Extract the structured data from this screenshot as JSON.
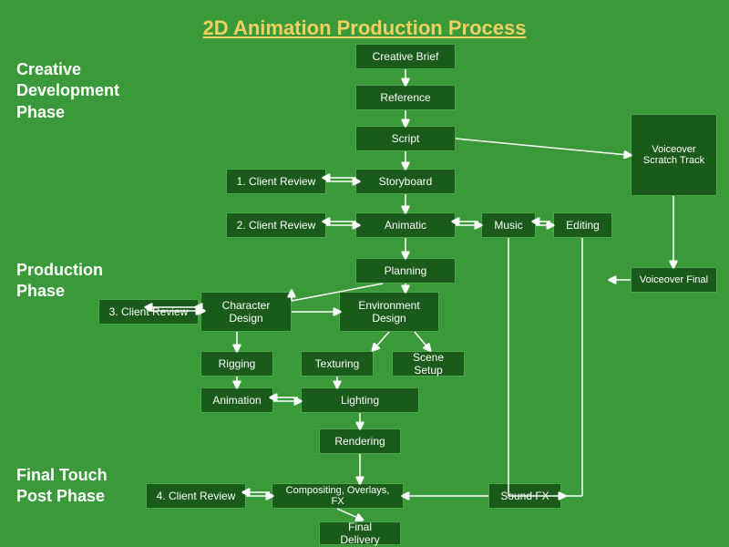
{
  "title": "2D Animation Production Process",
  "phases": {
    "creative": "Creative Development Phase",
    "production": "Production Phase",
    "final": "Final Touch Post Phase"
  },
  "boxes": {
    "creative_brief": "Creative Brief",
    "reference": "Reference",
    "script": "Script",
    "storyboard": "Storyboard",
    "animatic": "Animatic",
    "client_review_1": "1. Client Review",
    "client_review_2": "2. Client Review",
    "music": "Music",
    "editing": "Editing",
    "voiceover_scratch": "Voiceover Scratch Track",
    "voiceover_final": "Voiceover Final",
    "planning": "Planning",
    "client_review_3": "3. Client Review",
    "character_design": "Character Design",
    "environment_design": "Environment Design",
    "rigging": "Rigging",
    "texturing": "Texturing",
    "scene_setup": "Scene Setup",
    "animation": "Animation",
    "lighting": "Lighting",
    "rendering": "Rendering",
    "client_review_4": "4. Client Review",
    "compositing": "Compositing, Overlays, FX",
    "sound_fx": "Sound FX",
    "final_delivery": "Final Delivery"
  }
}
